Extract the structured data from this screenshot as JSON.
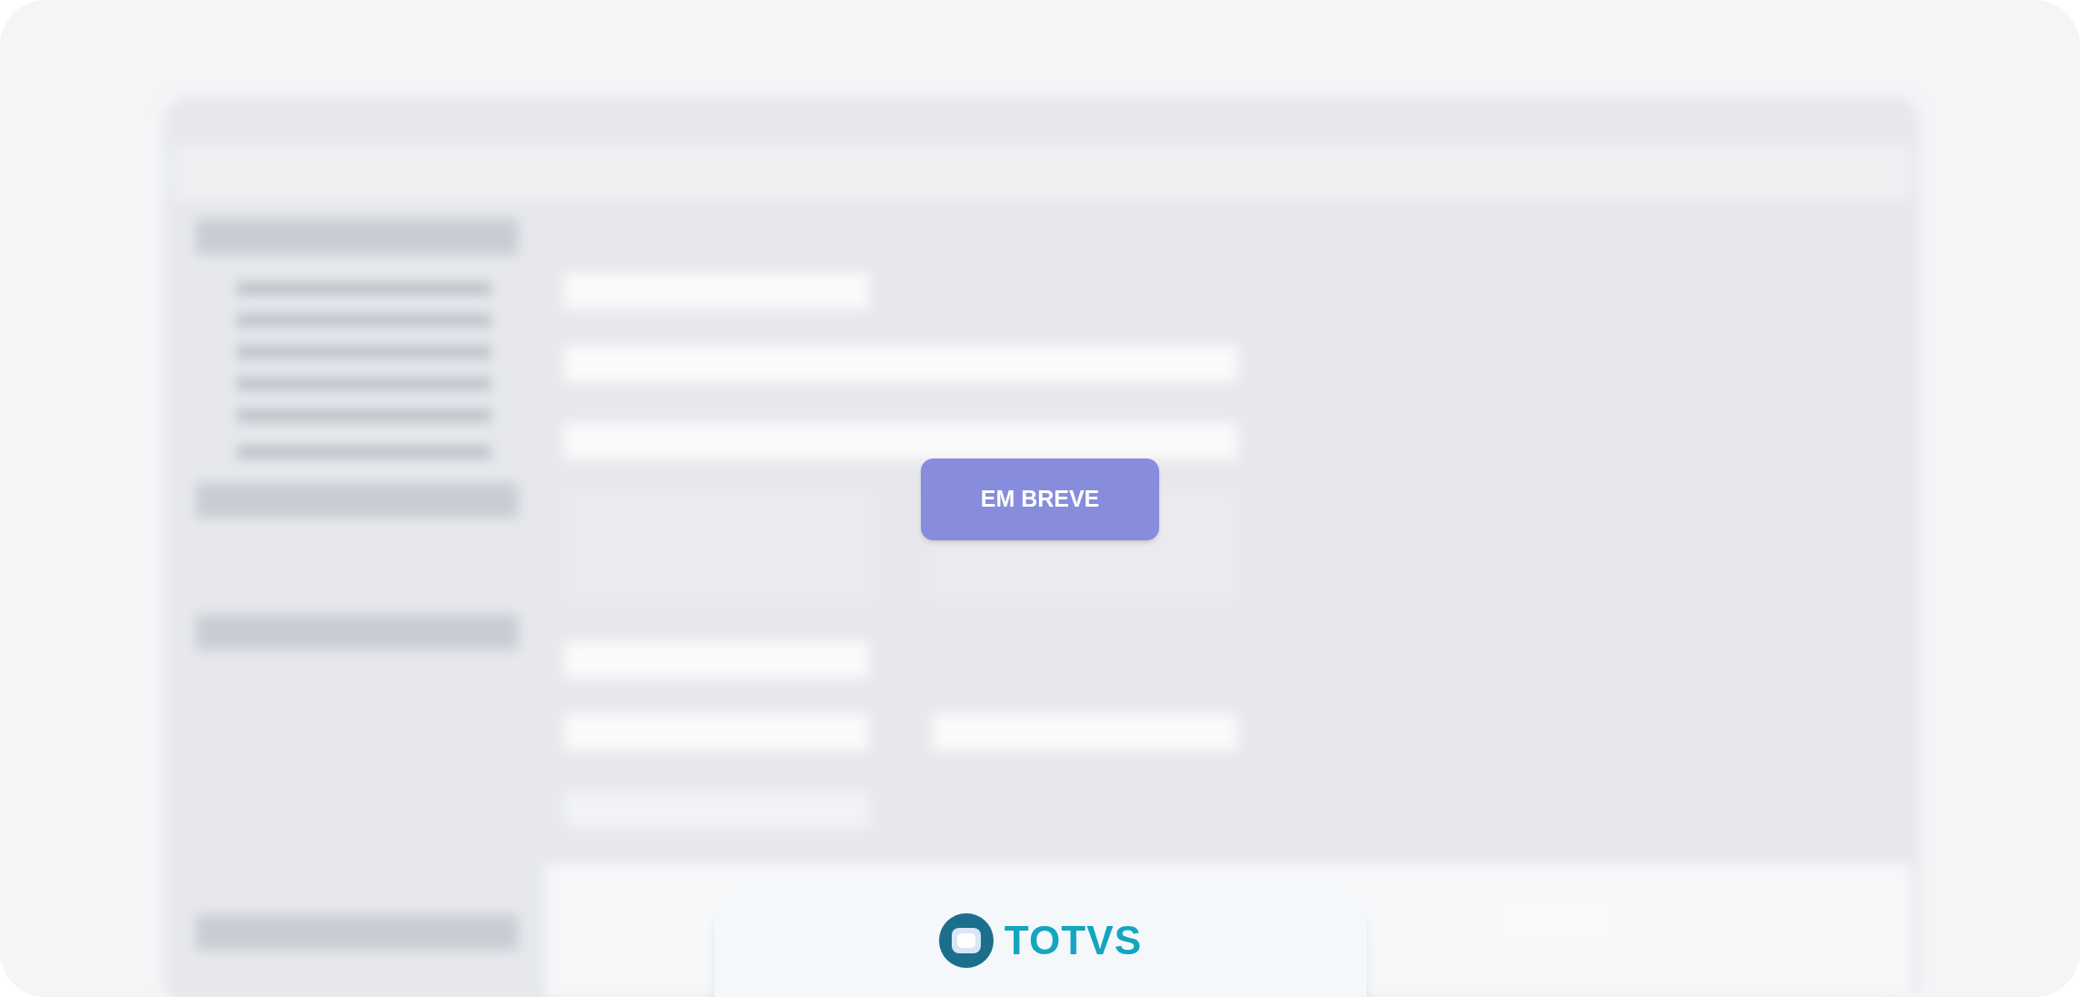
{
  "notice_button": {
    "label": "EM BREVE"
  },
  "footer": {
    "brand": "TOTVS"
  }
}
